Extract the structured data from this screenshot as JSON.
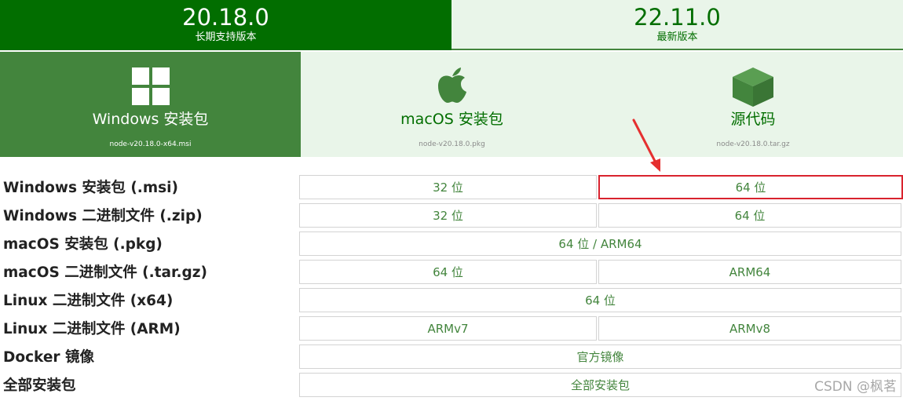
{
  "versions": {
    "lts": {
      "number": "20.18.0",
      "label": "长期支持版本"
    },
    "current": {
      "number": "22.11.0",
      "label": "最新版本"
    }
  },
  "cards": {
    "windows": {
      "title": "Windows 安装包",
      "file": "node-v20.18.0-x64.msi",
      "icon": "windows-logo-icon"
    },
    "macos": {
      "title": "macOS 安装包",
      "file": "node-v20.18.0.pkg",
      "icon": "apple-logo-icon"
    },
    "source": {
      "title": "源代码",
      "file": "node-v20.18.0.tar.gz",
      "icon": "package-box-icon"
    }
  },
  "table": {
    "rows": [
      {
        "label": "Windows 安装包 (.msi)",
        "cells": [
          "32 位",
          "64 位"
        ]
      },
      {
        "label": "Windows 二进制文件 (.zip)",
        "cells": [
          "32 位",
          "64 位"
        ]
      },
      {
        "label": "macOS 安装包 (.pkg)",
        "cells": [
          "64 位 / ARM64"
        ]
      },
      {
        "label": "macOS 二进制文件 (.tar.gz)",
        "cells": [
          "64 位",
          "ARM64"
        ]
      },
      {
        "label": "Linux 二进制文件 (x64)",
        "cells": [
          "64 位"
        ]
      },
      {
        "label": "Linux 二进制文件 (ARM)",
        "cells": [
          "ARMv7",
          "ARMv8"
        ]
      },
      {
        "label": "Docker 镜像",
        "cells": [
          "官方镜像"
        ]
      },
      {
        "label": "全部安装包",
        "cells": [
          "全部安装包"
        ]
      }
    ]
  },
  "annotation": {
    "highlighted_cell": "Windows 安装包 (.msi) / 64 位",
    "highlight_color": "#d9232e"
  },
  "watermark": "CSDN @枫茗",
  "colors": {
    "brand_dark": "#026e00",
    "brand": "#43853d",
    "light_bg": "#e9f5e9"
  }
}
